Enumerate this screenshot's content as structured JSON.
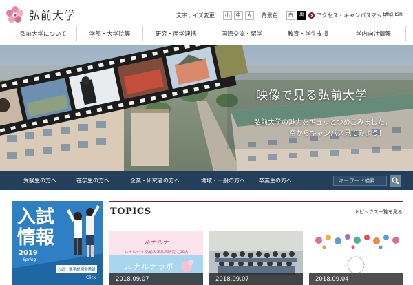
{
  "header": {
    "logo_text": "弘前大学",
    "font_size_label": "文字サイズ変更：",
    "font_sizes": [
      "小",
      "中",
      "大"
    ],
    "bg_color_label": "背景色：",
    "bg_colors": [
      "白",
      "黒"
    ],
    "access_link": "アクセス・キャンパスマップ",
    "english_link": "English"
  },
  "gnav": [
    "弘前大学について",
    "学部・大学院等",
    "研究・産学連携",
    "国際交流・留学",
    "教育・学生支援",
    "学内向け情報"
  ],
  "hero": {
    "title": "映像で見る弘前大学",
    "line1": "弘前大学の魅力をギュッとつめこみました。",
    "line2": "空からキャンパス見てみよう！"
  },
  "audience": [
    "受験生の方へ",
    "在学生の方へ",
    "企業・研究者の方へ",
    "地域・一般の方へ",
    "卒業生の方へ"
  ],
  "search": {
    "placeholder": "キーワード検索"
  },
  "banner": {
    "line1": "入試",
    "line2": "情報",
    "year": "2019",
    "season": "Spring",
    "sub": "入試・進学説明会情報",
    "click": "Click"
  },
  "topics": {
    "title": "TOPICS",
    "more": "トピックス一覧を見る",
    "cards": [
      {
        "date": "2018.09.07",
        "brand": "ルナルナ",
        "small": "ルナルナ × 弘前大学共同研究 ご案内",
        "big": "ルナルナラボ"
      },
      {
        "date": "2018.09.07"
      },
      {
        "date": "2018.09.04"
      }
    ]
  },
  "colors": {
    "nav_bar": "#243f5b",
    "accent_red": "#7a1f2b",
    "banner_blue": "#2e7fc4"
  }
}
